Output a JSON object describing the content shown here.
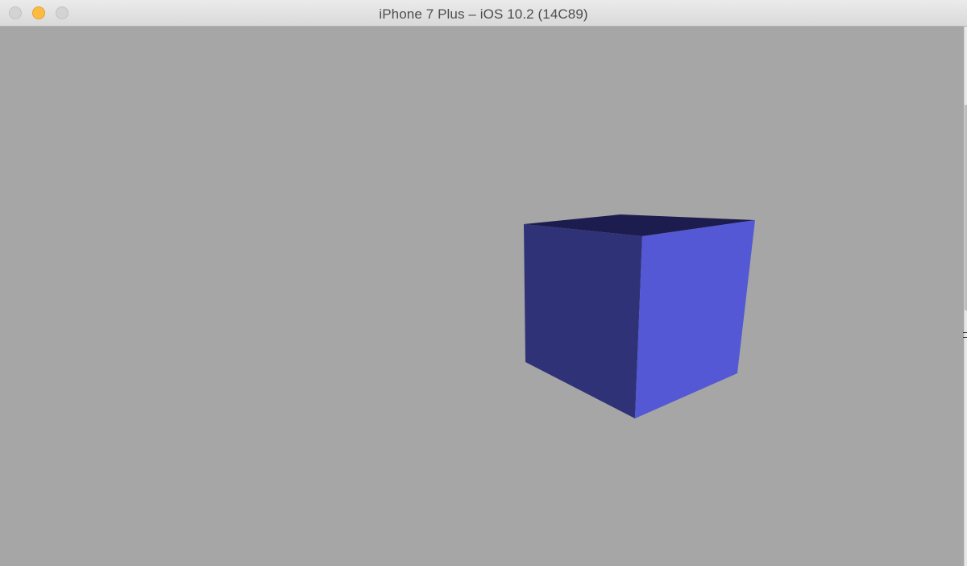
{
  "window": {
    "title": "iPhone 7 Plus – iOS 10.2 (14C89)"
  },
  "titlebar_buttons": {
    "close_icon": "close-icon",
    "minimize_icon": "minimize-icon",
    "zoom_icon": "zoom-icon"
  },
  "scene": {
    "background_color": "#a6a6a6",
    "object": "cube",
    "colors": {
      "top_face": "#1c1d4e",
      "left_face": "#303278",
      "right_face": "#5458d4"
    }
  }
}
